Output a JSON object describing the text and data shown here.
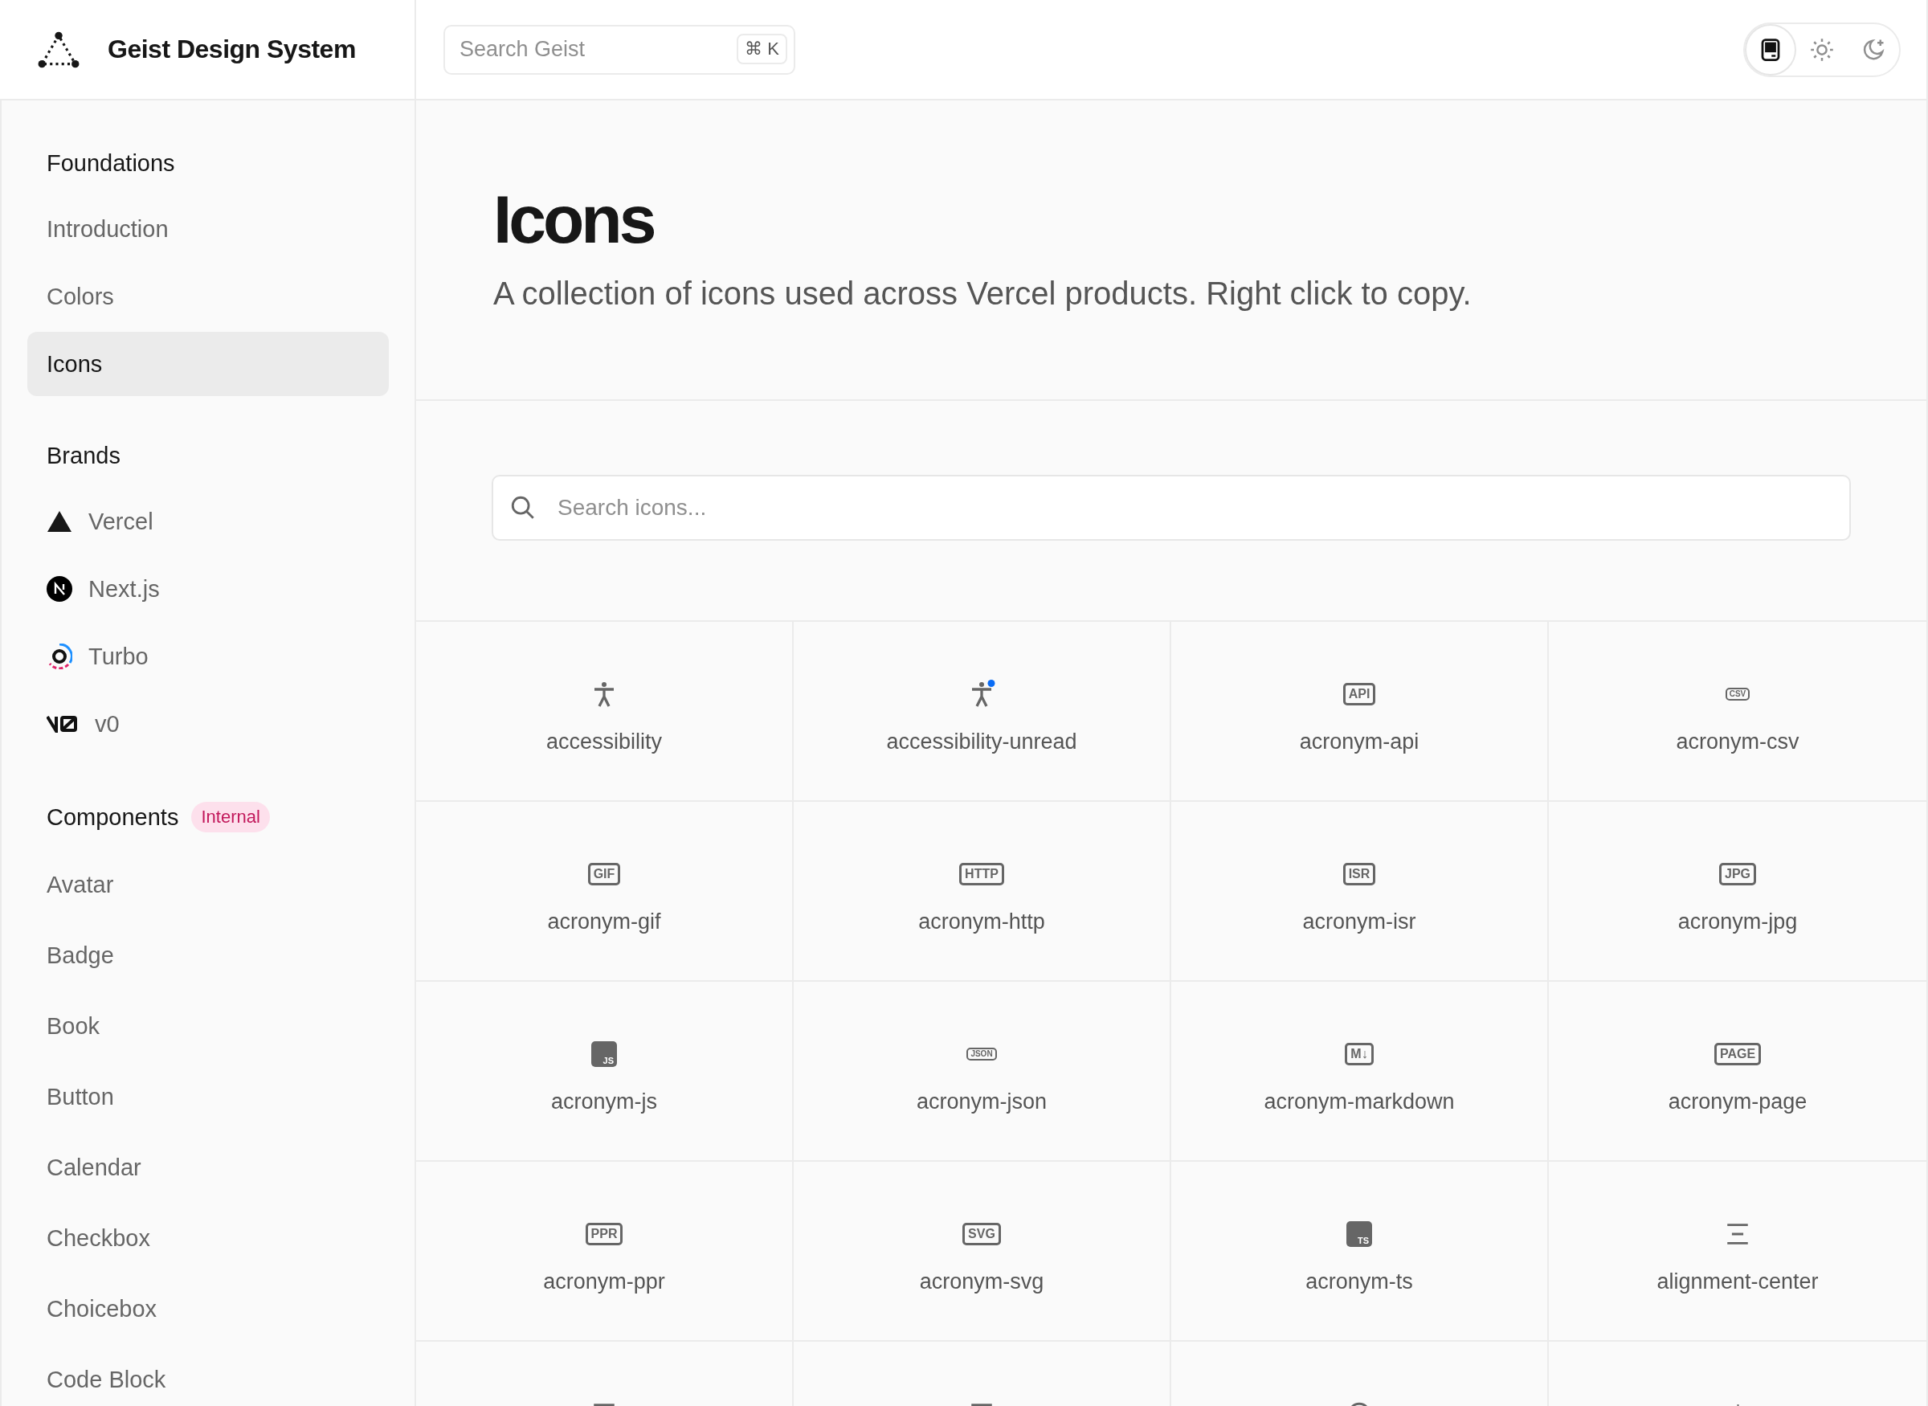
{
  "header": {
    "title": "Geist Design System",
    "search": {
      "placeholder": "Search Geist",
      "shortcut": "⌘ K"
    },
    "theme_buttons": [
      {
        "kind": "device",
        "selected": true
      },
      {
        "kind": "sun",
        "selected": false
      },
      {
        "kind": "moon",
        "selected": false
      }
    ]
  },
  "sidebar": {
    "sections": [
      {
        "heading": "Foundations",
        "items": [
          {
            "label": "Introduction",
            "selected": false
          },
          {
            "label": "Colors",
            "selected": false
          },
          {
            "label": "Icons",
            "selected": true
          }
        ]
      },
      {
        "heading": "Brands",
        "items": [
          {
            "label": "Vercel",
            "kind": "triangle",
            "selected": false
          },
          {
            "label": "Next.js",
            "kind": "next",
            "selected": false
          },
          {
            "label": "Turbo",
            "kind": "turbo",
            "selected": false
          },
          {
            "label": "v0",
            "kind": "v0",
            "selected": false
          }
        ]
      },
      {
        "heading": "Components",
        "badge": "Internal",
        "items": [
          {
            "label": "Avatar",
            "selected": false
          },
          {
            "label": "Badge",
            "selected": false
          },
          {
            "label": "Book",
            "selected": false
          },
          {
            "label": "Button",
            "selected": false
          },
          {
            "label": "Calendar",
            "selected": false
          },
          {
            "label": "Checkbox",
            "selected": false
          },
          {
            "label": "Choicebox",
            "selected": false
          },
          {
            "label": "Code Block",
            "selected": false
          }
        ]
      }
    ]
  },
  "page": {
    "title": "Icons",
    "subtitle": "A collection of icons used across Vercel products. Right click to copy.",
    "search": {
      "placeholder": "Search icons..."
    }
  },
  "icons": [
    {
      "label": "accessibility",
      "icon": {
        "kind": "person"
      }
    },
    {
      "label": "accessibility-unread",
      "icon": {
        "kind": "person-dot"
      }
    },
    {
      "label": "acronym-api",
      "icon": {
        "kind": "acronym",
        "text": "API"
      }
    },
    {
      "label": "acronym-csv",
      "icon": {
        "kind": "acronym-small",
        "text": "CSV"
      }
    },
    {
      "label": "acronym-gif",
      "icon": {
        "kind": "acronym",
        "text": "GIF"
      }
    },
    {
      "label": "acronym-http",
      "icon": {
        "kind": "acronym",
        "text": "HTTP"
      }
    },
    {
      "label": "acronym-isr",
      "icon": {
        "kind": "acronym",
        "text": "ISR"
      }
    },
    {
      "label": "acronym-jpg",
      "icon": {
        "kind": "acronym",
        "text": "JPG"
      }
    },
    {
      "label": "acronym-js",
      "icon": {
        "kind": "filled",
        "text": "JS"
      }
    },
    {
      "label": "acronym-json",
      "icon": {
        "kind": "acronym-small",
        "text": "JSON"
      }
    },
    {
      "label": "acronym-markdown",
      "icon": {
        "kind": "acronym",
        "text": "M↓"
      }
    },
    {
      "label": "acronym-page",
      "icon": {
        "kind": "acronym",
        "text": "PAGE"
      }
    },
    {
      "label": "acronym-ppr",
      "icon": {
        "kind": "acronym",
        "text": "PPR"
      }
    },
    {
      "label": "acronym-svg",
      "icon": {
        "kind": "acronym",
        "text": "SVG"
      }
    },
    {
      "label": "acronym-ts",
      "icon": {
        "kind": "filled",
        "text": "TS"
      }
    },
    {
      "label": "alignment-center",
      "icon": {
        "kind": "align-center"
      }
    },
    {
      "icon": {
        "kind": "align-left"
      }
    },
    {
      "icon": {
        "kind": "align-left"
      }
    },
    {
      "icon": {
        "kind": "circle"
      }
    },
    {
      "icon": {
        "kind": "line"
      }
    }
  ]
}
